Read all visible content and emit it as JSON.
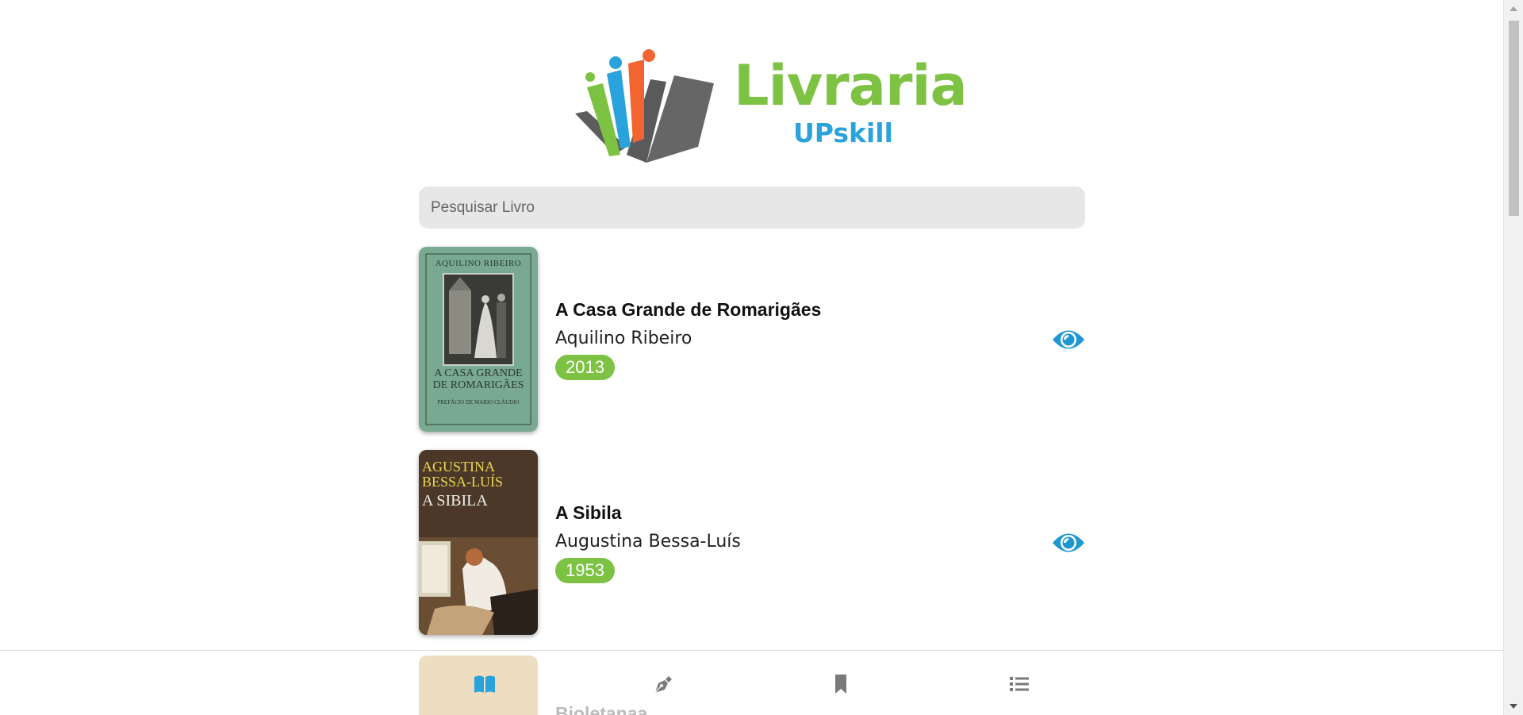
{
  "brand": {
    "name": "Livraria",
    "subtitle": "UPskill"
  },
  "search": {
    "placeholder": "Pesquisar Livro",
    "value": ""
  },
  "books": [
    {
      "title": "A Casa Grande de Romarigães",
      "author": "Aquilino Ribeiro",
      "year": "2013",
      "cover": {
        "top_text": "AQUILINO RIBEIRO",
        "title_text": "A CASA GRANDE DE ROMARIGÃES",
        "bottom_text": "PREFÁCIO DE MARIO CLÁUDIO",
        "color": "#79a990"
      }
    },
    {
      "title": "A Sibila",
      "author": "Augustina Bessa-Luís",
      "year": "1953",
      "cover": {
        "top_text": "AGUSTINA BESSA-LUÍS",
        "title_text": "A SIBILA",
        "color": "#4a3a2a"
      }
    }
  ],
  "peek_book": {
    "title": "Bioletanaa"
  },
  "nav": {
    "items": [
      {
        "icon": "book-open-icon",
        "active": true
      },
      {
        "icon": "pen-nib-icon",
        "active": false
      },
      {
        "icon": "bookmark-icon",
        "active": false
      },
      {
        "icon": "list-icon",
        "active": false
      }
    ]
  },
  "colors": {
    "accent_green": "#7dc242",
    "accent_blue": "#2aa3dc",
    "nav_active": "#2aa3dc",
    "nav_inactive": "#7a7a7a",
    "search_bg": "#e7e7e7"
  }
}
